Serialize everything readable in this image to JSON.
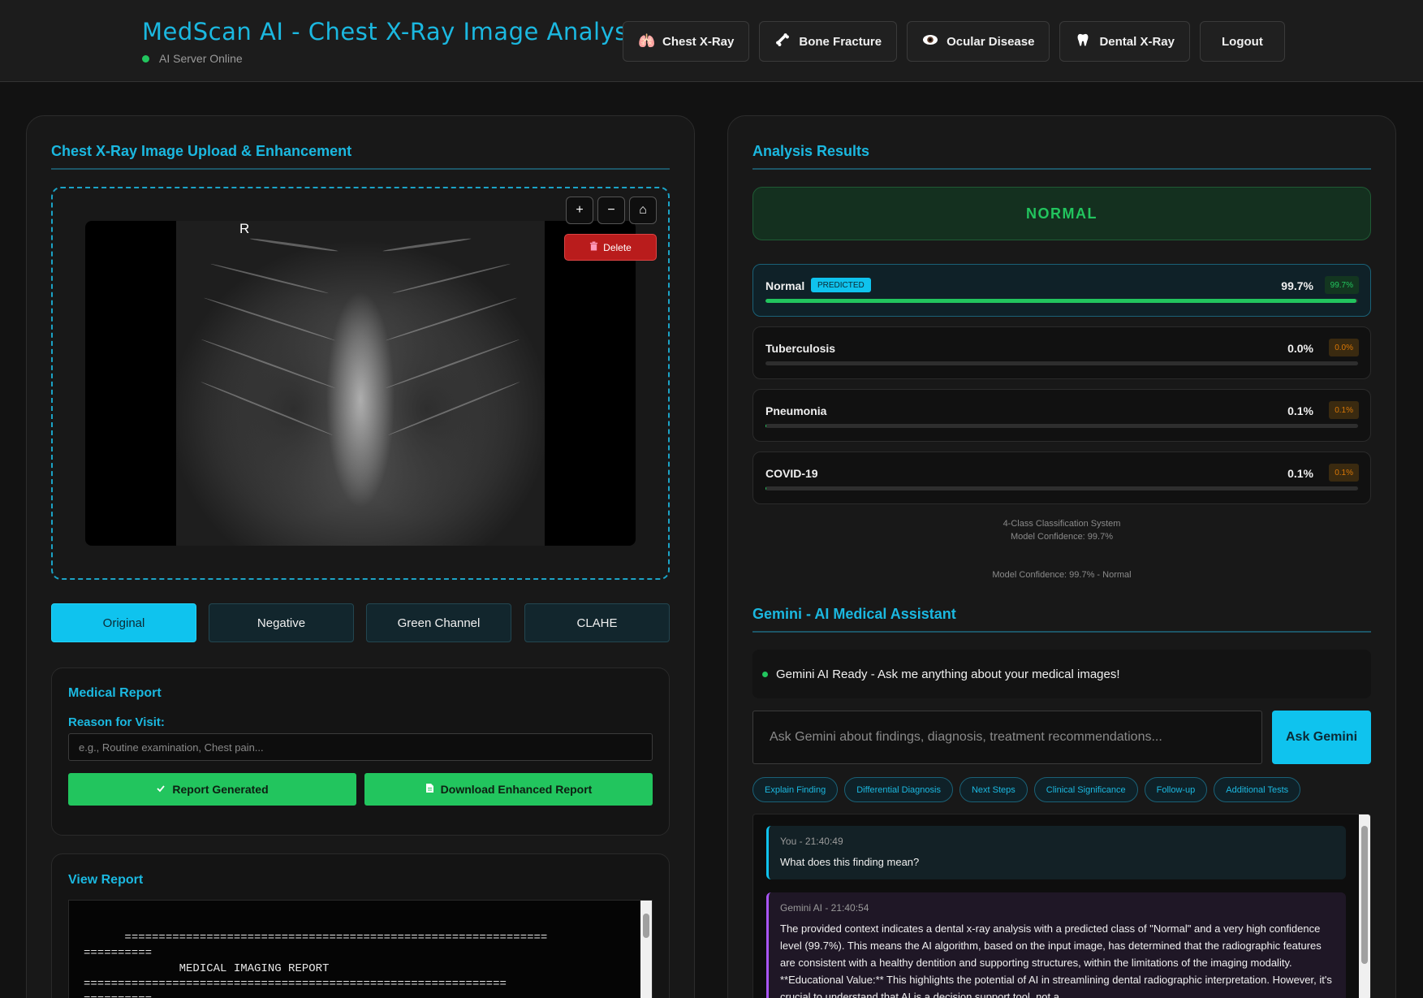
{
  "header": {
    "title": "MedScan AI - Chest X-Ray Image Analysis",
    "server_status": "AI Server Online",
    "nav": [
      {
        "label": "Chest X-Ray",
        "icon": "lungs-icon"
      },
      {
        "label": "Bone Fracture",
        "icon": "bone-icon"
      },
      {
        "label": "Ocular Disease",
        "icon": "eye-icon"
      },
      {
        "label": "Dental X-Ray",
        "icon": "tooth-icon"
      }
    ],
    "logout_label": "Logout"
  },
  "upload": {
    "title": "Chest X-Ray Image Upload & Enhancement",
    "image_marker": "R",
    "zoom_in": "+",
    "zoom_out": "−",
    "home": "⌂",
    "delete_label": "Delete"
  },
  "enhancements": {
    "active": "Original",
    "items": [
      "Original",
      "Negative",
      "Green Channel",
      "CLAHE"
    ]
  },
  "medical_report": {
    "title": "Medical Report",
    "reason_label": "Reason for Visit:",
    "reason_placeholder": "e.g., Routine examination, Chest pain...",
    "generated_label": "Report Generated",
    "download_label": "Download Enhanced Report"
  },
  "view_report": {
    "title": "View Report",
    "text": "==============================================================\n==========\n              MEDICAL IMAGING REPORT\n==============================================================\n=========="
  },
  "analysis": {
    "title": "Analysis Results",
    "verdict": "NORMAL",
    "predicted_badge": "PREDICTED",
    "classes": [
      {
        "name": "Normal",
        "pct": "99.7%",
        "chip": "99.7%",
        "value": 99.7,
        "predicted": true
      },
      {
        "name": "Tuberculosis",
        "pct": "0.0%",
        "chip": "0.0%",
        "value": 0.0,
        "predicted": false
      },
      {
        "name": "Pneumonia",
        "pct": "0.1%",
        "chip": "0.1%",
        "value": 0.1,
        "predicted": false
      },
      {
        "name": "COVID-19",
        "pct": "0.1%",
        "chip": "0.1%",
        "value": 0.1,
        "predicted": false
      }
    ],
    "system_line": "4-Class Classification System",
    "confidence_line": "Model Confidence: 99.7%",
    "confidence_summary": "Model Confidence: 99.7% - Normal"
  },
  "gemini": {
    "title": "Gemini - AI Medical Assistant",
    "status": "Gemini AI Ready - Ask me anything about your medical images!",
    "ask_placeholder": "Ask Gemini about findings, diagnosis, treatment recommendations...",
    "ask_label": "Ask Gemini",
    "quick_prompts": [
      "Explain Finding",
      "Differential Diagnosis",
      "Next Steps",
      "Clinical Significance",
      "Follow-up",
      "Additional Tests"
    ],
    "messages": [
      {
        "meta": "You - 21:40:49",
        "text": "What does this finding mean?"
      },
      {
        "meta": "Gemini AI - 21:40:54",
        "text": "The provided context indicates a dental x-ray analysis with a predicted class of \"Normal\" and a very high confidence level (99.7%). This means the AI algorithm, based on the input image, has determined that the radiographic features are consistent with a healthy dentition and supporting structures, within the limitations of the imaging modality. **Educational Value:** This highlights the potential of AI in streamlining dental radiographic interpretation. However, it's crucial to understand that AI is a decision support tool, not a"
      }
    ]
  },
  "colors": {
    "accent": "#1bb8e0",
    "success": "#22c55e",
    "danger": "#b91c1c",
    "warning": "#d97706"
  }
}
